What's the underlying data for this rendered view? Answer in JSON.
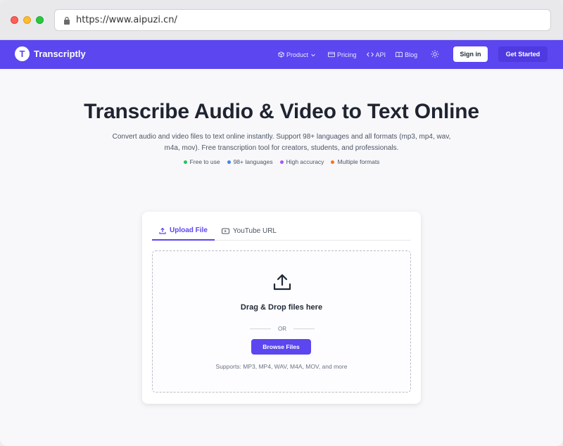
{
  "browser": {
    "url": "https://www.aipuzi.cn/"
  },
  "nav": {
    "brand_letter": "T",
    "brand_name": "Transcriptly",
    "links": [
      {
        "label": "Product",
        "icon": "cube-icon"
      },
      {
        "label": "Pricing",
        "icon": "card-icon"
      },
      {
        "label": "API",
        "icon": "code-icon"
      },
      {
        "label": "Blog",
        "icon": "book-icon"
      }
    ],
    "sign_in": "Sign in",
    "get_started": "Get Started"
  },
  "hero": {
    "title": "Transcribe Audio & Video to Text Online",
    "subtitle": "Convert audio and video files to text online instantly. Support 98+ languages and all formats (mp3, mp4, wav, m4a, mov). Free transcription tool for creators, students, and professionals.",
    "features": [
      {
        "label": "Free to use",
        "color": "#22c55e"
      },
      {
        "label": "98+ languages",
        "color": "#3b82f6"
      },
      {
        "label": "High accuracy",
        "color": "#a855f7"
      },
      {
        "label": "Multiple formats",
        "color": "#f97316"
      }
    ]
  },
  "upload": {
    "tabs": [
      {
        "label": "Upload File",
        "icon": "upload-icon",
        "active": true
      },
      {
        "label": "YouTube URL",
        "icon": "video-icon",
        "active": false
      }
    ],
    "drop_title": "Drag & Drop files here",
    "or": "OR",
    "browse": "Browse Files",
    "supports": "Supports: MP3, MP4, WAV, M4A, MOV, and more"
  },
  "colors": {
    "brand": "#5b46f0",
    "brand_dark": "#4f3ae0"
  }
}
